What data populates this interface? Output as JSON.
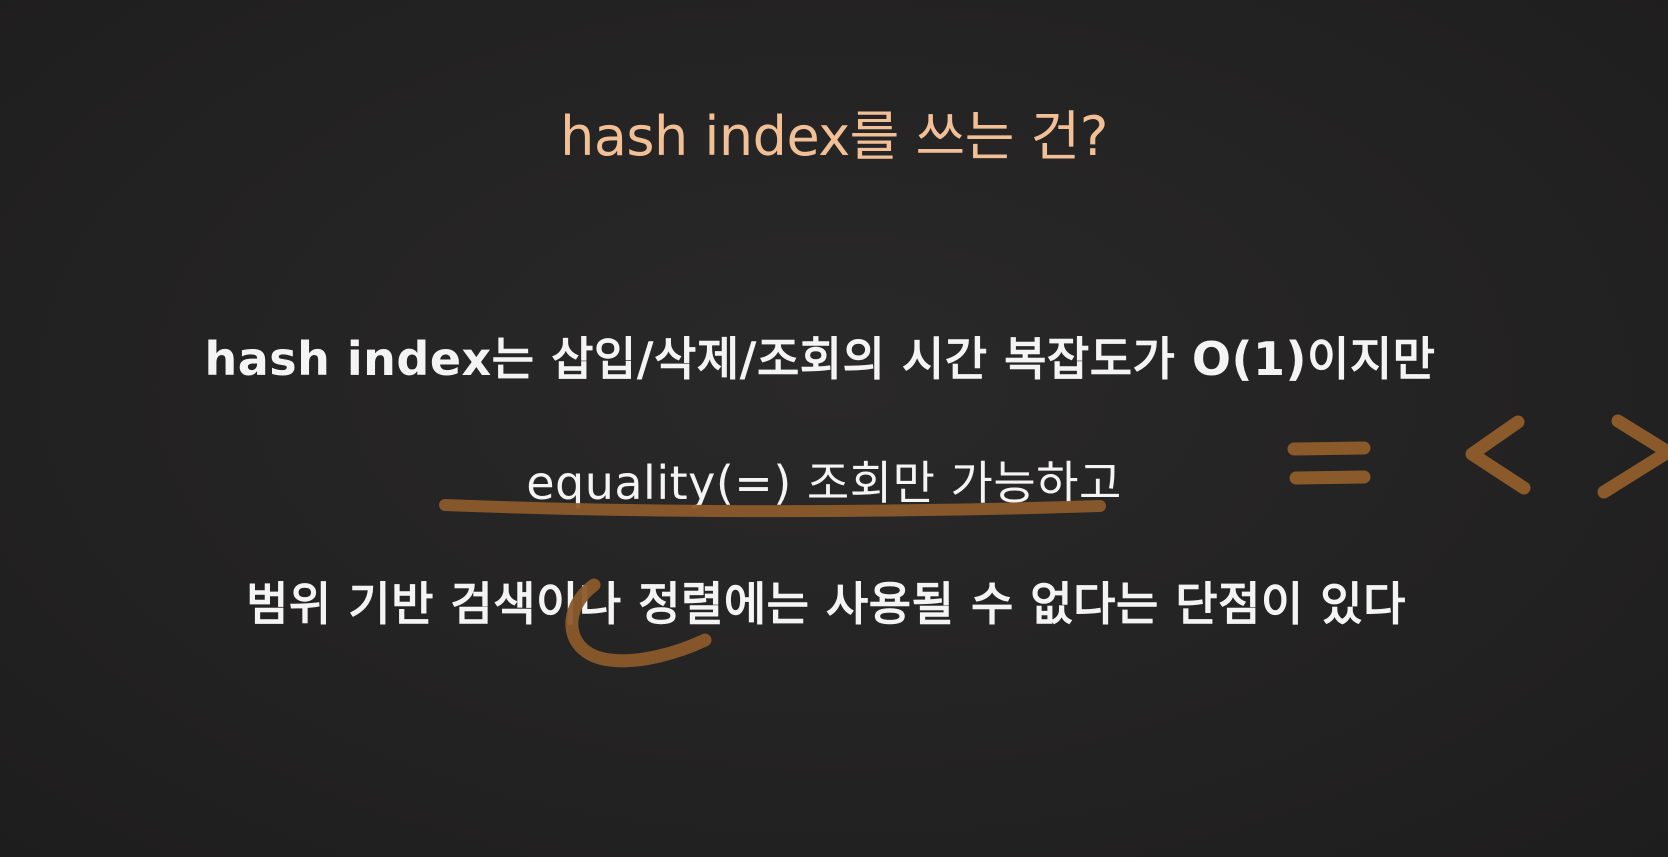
{
  "slide": {
    "title": "hash index를 쓰는 건?",
    "lines": [
      "hash index는 삽입/삭제/조회의 시간 복잡도가 O(1)이지만",
      "equality(=) 조회만 가능하고",
      "범위 기반 검색이나 정렬에는 사용될 수 없다는 단점이 있다"
    ]
  },
  "colors": {
    "background": "#232222",
    "title": "#f2c097",
    "body_text": "#f4f4f4",
    "annotation_stroke": "#8a5a2a"
  }
}
